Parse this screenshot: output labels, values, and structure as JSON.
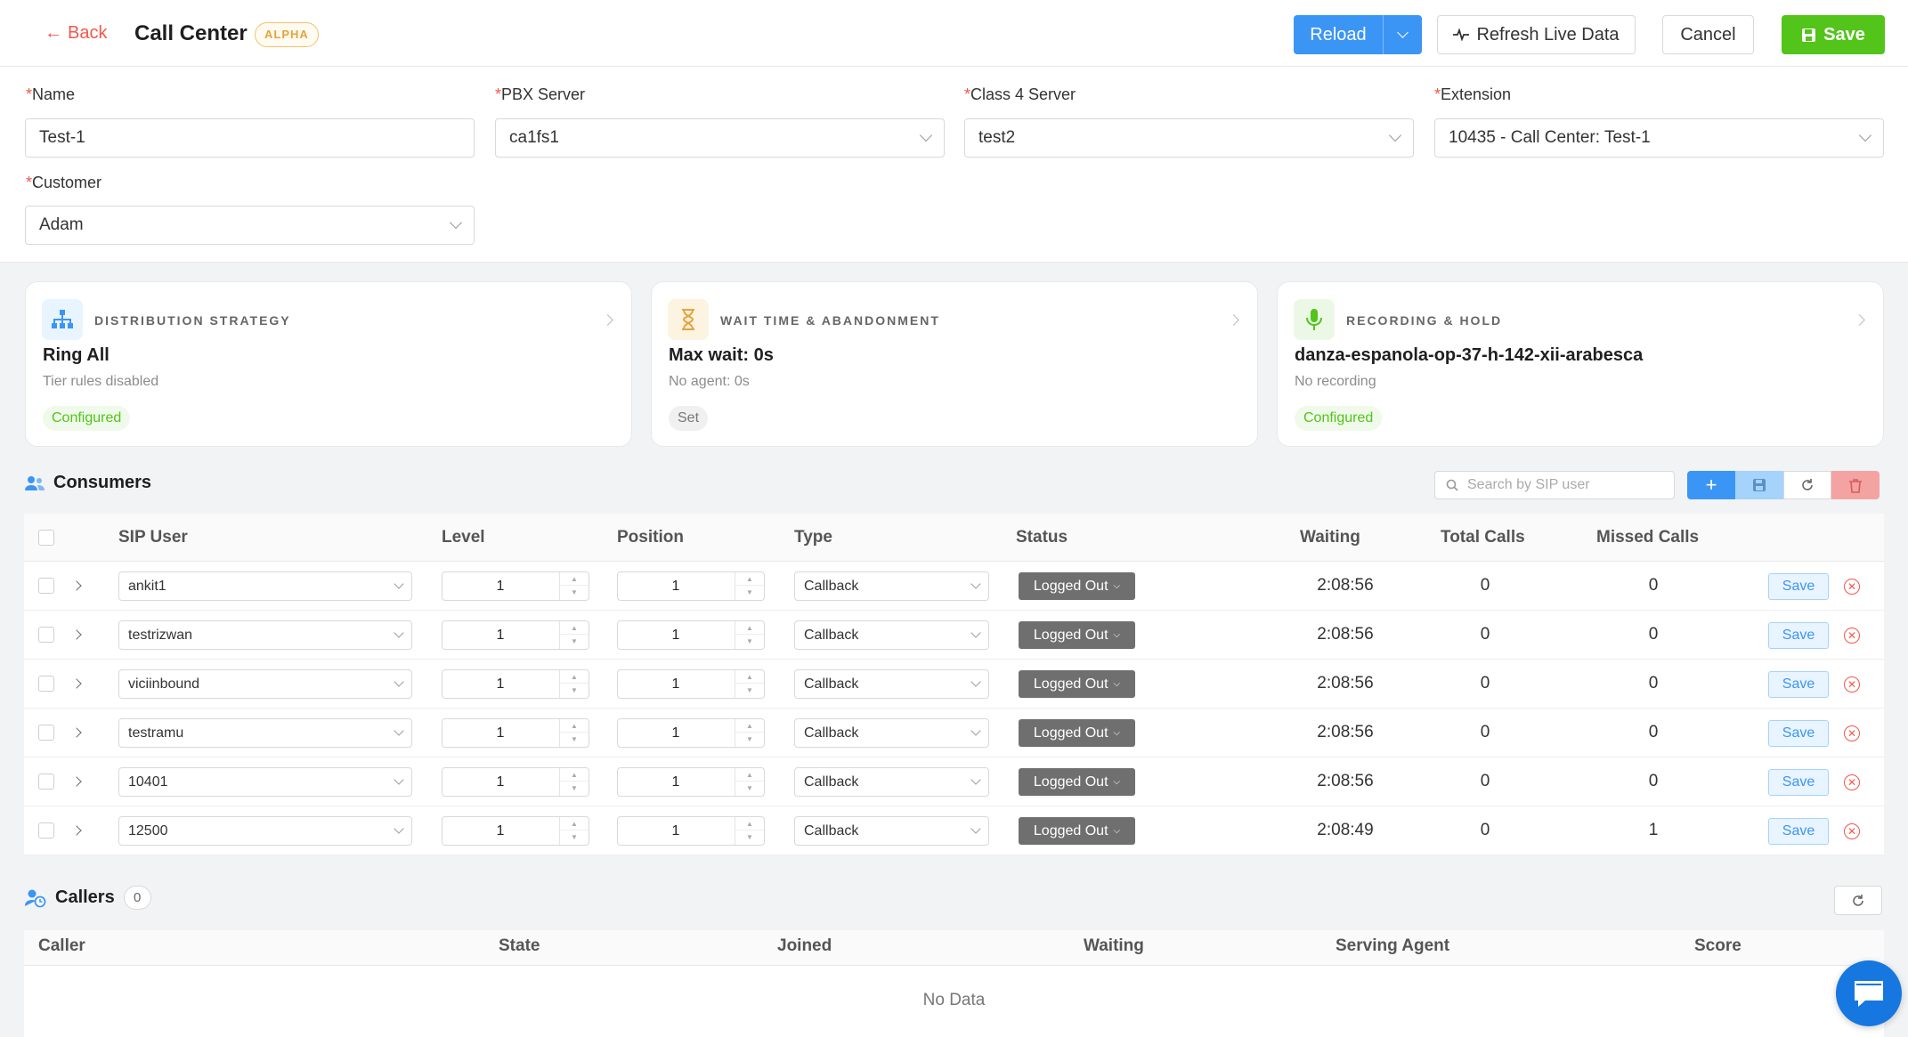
{
  "header": {
    "back_label": "Back",
    "title": "Call Center",
    "badge": "ALPHA",
    "reload_label": "Reload",
    "refresh_label": "Refresh Live Data",
    "cancel_label": "Cancel",
    "save_label": "Save"
  },
  "form": {
    "name": {
      "label": "Name",
      "value": "Test-1"
    },
    "pbx_server": {
      "label": "PBX Server",
      "value": "ca1fs1"
    },
    "class4_server": {
      "label": "Class 4 Server",
      "value": "test2"
    },
    "extension": {
      "label": "Extension",
      "value": "10435 - Call Center: Test-1"
    },
    "customer": {
      "label": "Customer",
      "value": "Adam"
    }
  },
  "cards": [
    {
      "heading": "DISTRIBUTION STRATEGY",
      "main": "Ring All",
      "sub": "Tier rules disabled",
      "badge": "Configured",
      "icon": "org-chart-icon",
      "accent": "#3b95f5"
    },
    {
      "heading": "WAIT TIME & ABANDONMENT",
      "main": "Max wait: 0s",
      "sub": "No agent: 0s",
      "badge": "Set",
      "icon": "hourglass-icon",
      "accent": "#e6a23c"
    },
    {
      "heading": "RECORDING & HOLD",
      "main": "danza-espanola-op-37-h-142-xii-arabesca",
      "sub": "No recording",
      "badge": "Configured",
      "icon": "microphone-icon",
      "accent": "#52c41a"
    }
  ],
  "consumers": {
    "title": "Consumers",
    "search_placeholder": "Search by SIP user",
    "columns": [
      "SIP User",
      "Level",
      "Position",
      "Type",
      "Status",
      "Waiting",
      "Total Calls",
      "Missed Calls"
    ],
    "rows": [
      {
        "sip_user": "ankit1",
        "level": "1",
        "position": "1",
        "type": "Callback",
        "status": "Logged Out",
        "waiting": "2:08:56",
        "total_calls": "0",
        "missed_calls": "0",
        "save": "Save"
      },
      {
        "sip_user": "testrizwan",
        "level": "1",
        "position": "1",
        "type": "Callback",
        "status": "Logged Out",
        "waiting": "2:08:56",
        "total_calls": "0",
        "missed_calls": "0",
        "save": "Save"
      },
      {
        "sip_user": "viciinbound",
        "level": "1",
        "position": "1",
        "type": "Callback",
        "status": "Logged Out",
        "waiting": "2:08:56",
        "total_calls": "0",
        "missed_calls": "0",
        "save": "Save"
      },
      {
        "sip_user": "testramu",
        "level": "1",
        "position": "1",
        "type": "Callback",
        "status": "Logged Out",
        "waiting": "2:08:56",
        "total_calls": "0",
        "missed_calls": "0",
        "save": "Save"
      },
      {
        "sip_user": "10401",
        "level": "1",
        "position": "1",
        "type": "Callback",
        "status": "Logged Out",
        "waiting": "2:08:56",
        "total_calls": "0",
        "missed_calls": "0",
        "save": "Save"
      },
      {
        "sip_user": "12500",
        "level": "1",
        "position": "1",
        "type": "Callback",
        "status": "Logged Out",
        "waiting": "2:08:49",
        "total_calls": "0",
        "missed_calls": "1",
        "save": "Save"
      }
    ]
  },
  "callers": {
    "title": "Callers",
    "count": "0",
    "columns": [
      "Caller",
      "State",
      "Joined",
      "Waiting",
      "Serving Agent",
      "Score"
    ],
    "empty_text": "No Data"
  },
  "colors": {
    "primary": "#3b95f5",
    "success": "#52c41a",
    "danger": "#f5564a",
    "status_bg": "#6f6f6f"
  }
}
